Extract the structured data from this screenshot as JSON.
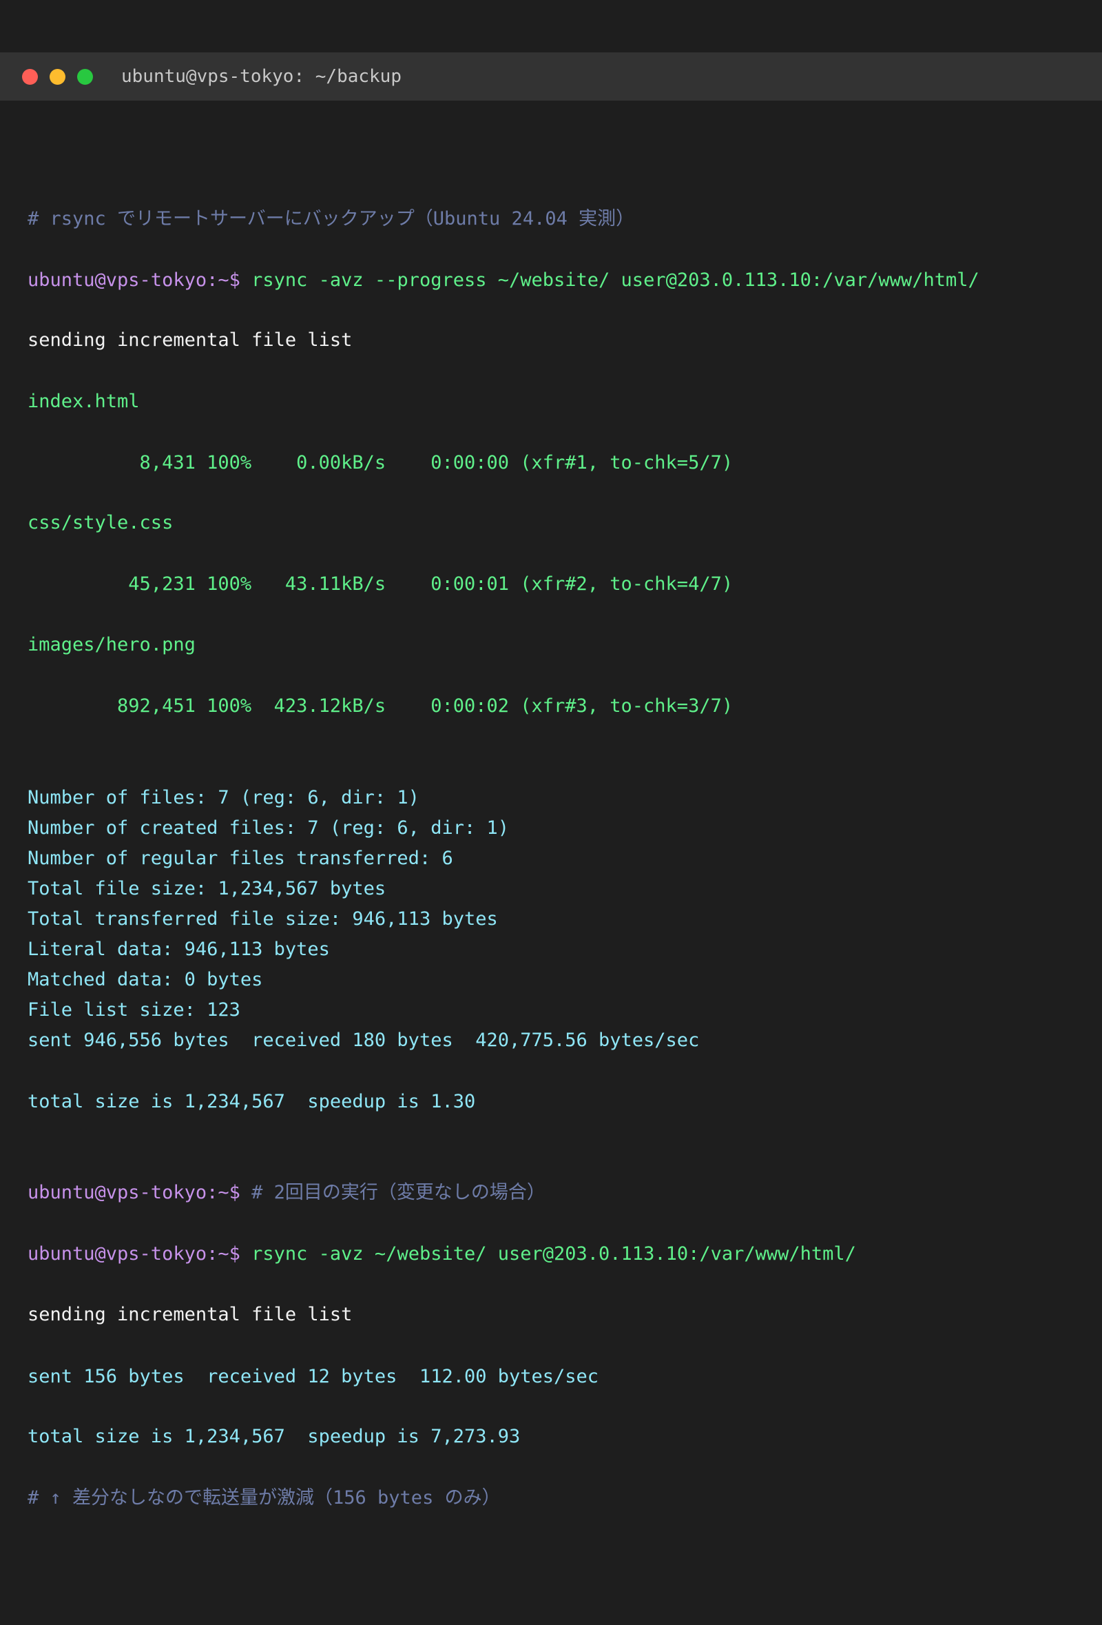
{
  "window": {
    "title": "ubuntu@vps-tokyo: ~/backup"
  },
  "terminal": {
    "comment_1": "# rsync でリモートサーバーにバックアップ（Ubuntu 24.04 実測）",
    "prompt": "ubuntu@vps-tokyo:~$",
    "cmd_1": "rsync -avz --progress ~/website/ user@203.0.113.10:/var/www/html/",
    "sending_1": "sending incremental file list",
    "files": [
      {
        "name": "index.html",
        "progress": "          8,431 100%    0.00kB/s    0:00:00 (xfr#1, to-chk=5/7)"
      },
      {
        "name": "css/style.css",
        "progress": "         45,231 100%   43.11kB/s    0:00:01 (xfr#2, to-chk=4/7)"
      },
      {
        "name": "images/hero.png",
        "progress": "        892,451 100%  423.12kB/s    0:00:02 (xfr#3, to-chk=3/7)"
      }
    ],
    "stats": [
      "Number of files: 7 (reg: 6, dir: 1)",
      "Number of created files: 7 (reg: 6, dir: 1)",
      "Number of regular files transferred: 6",
      "Total file size: 1,234,567 bytes",
      "Total transferred file size: 946,113 bytes",
      "Literal data: 946,113 bytes",
      "Matched data: 0 bytes",
      "File list size: 123",
      "sent 946,556 bytes  received 180 bytes  420,775.56 bytes/sec"
    ],
    "total_1": "total size is 1,234,567  speedup is 1.30",
    "comment_2": "# 2回目の実行（変更なしの場合）",
    "cmd_2": "rsync -avz ~/website/ user@203.0.113.10:/var/www/html/",
    "sending_2": "sending incremental file list",
    "sent_2": "sent 156 bytes  received 12 bytes  112.00 bytes/sec",
    "total_2": "total size is 1,234,567  speedup is 7,273.93",
    "comment_3": "# ↑ 差分なしなので転送量が激減（156 bytes のみ）"
  },
  "colors": {
    "background": "#1e1e1e",
    "titlebar": "#333333",
    "comment": "#6e7ca8",
    "prompt": "#c792ea",
    "command": "#5ff08a",
    "stats": "#8fe6f6"
  }
}
